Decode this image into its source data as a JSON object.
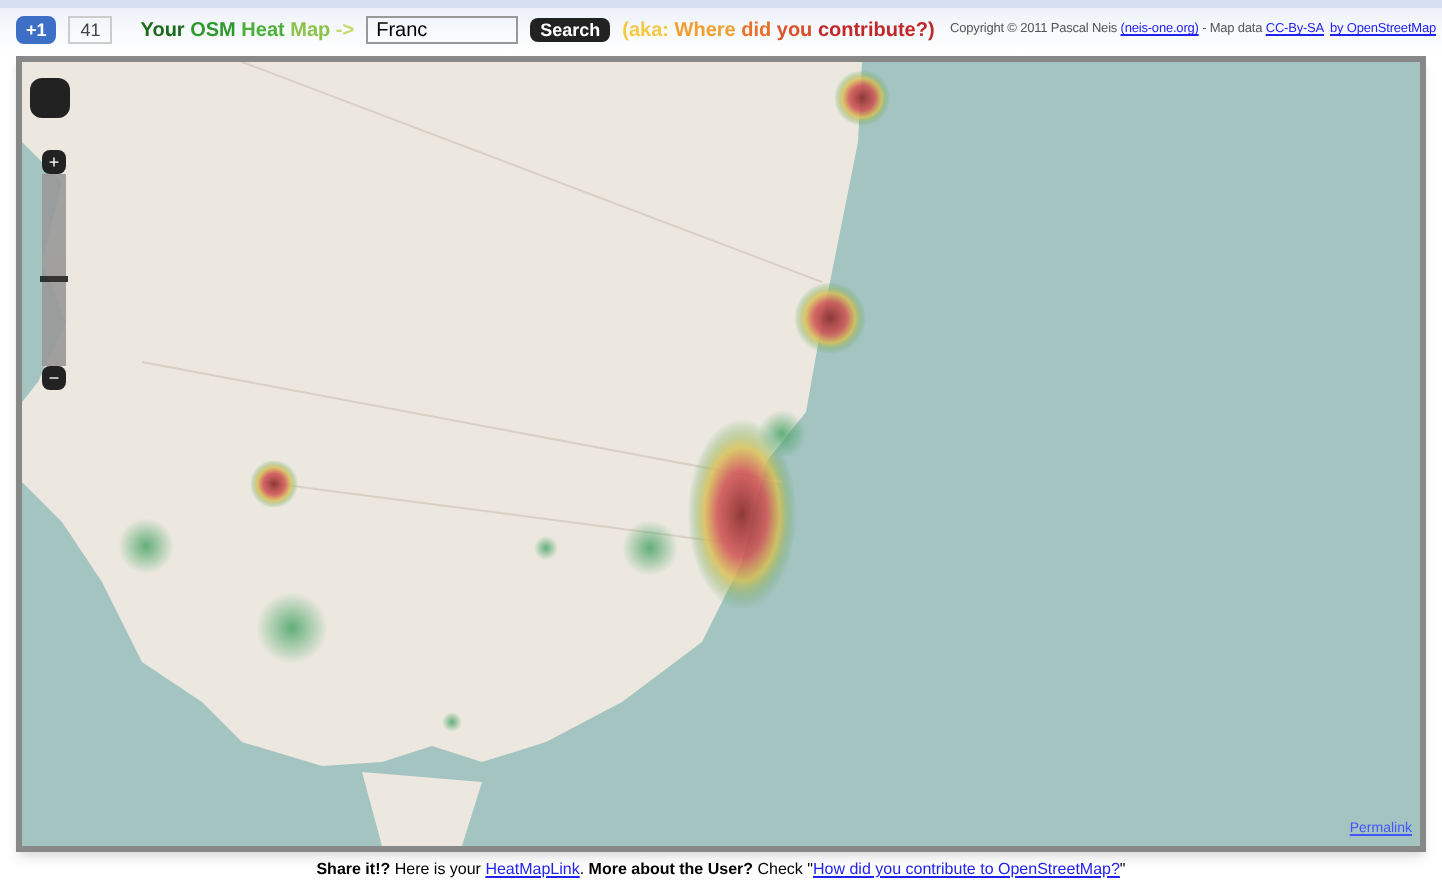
{
  "header": {
    "plus_one": {
      "label": "+1",
      "count": "41"
    },
    "title_parts": [
      {
        "text": "Your",
        "color": "#1a6b1a"
      },
      {
        "text": "OSM",
        "color": "#2e9a2e"
      },
      {
        "text": "Heat",
        "color": "#4caf3a"
      },
      {
        "text": "Map",
        "color": "#8bc34a"
      },
      {
        "text": "->",
        "color": "#c5d86d"
      }
    ],
    "search": {
      "value": "Franc",
      "button": "Search"
    },
    "tagline_parts": [
      {
        "text": "(aka:",
        "color": "#f5c842"
      },
      {
        "text": "Where",
        "color": "#f0a030"
      },
      {
        "text": "did",
        "color": "#e8702a"
      },
      {
        "text": "you",
        "color": "#d9502a"
      },
      {
        "text": "contribute?)",
        "color": "#c0282a"
      }
    ],
    "copyright": [
      {
        "kind": "text",
        "text": "Copyright © 2011 Pascal Neis "
      },
      {
        "kind": "link",
        "text": "(neis-one.org)"
      },
      {
        "kind": "text",
        "text": " - Map data "
      },
      {
        "kind": "link",
        "text": "CC-By-SA"
      },
      {
        "kind": "link",
        "text": "by OpenStreetMap"
      }
    ]
  },
  "map": {
    "zoom": {
      "in": "+",
      "out": "−",
      "level": 0.45
    },
    "permalink": "Permalink"
  },
  "footer": [
    {
      "kind": "bold",
      "text": "Share it!?"
    },
    {
      "kind": "text",
      "text": " Here is your "
    },
    {
      "kind": "link",
      "text": "HeatMapLink"
    },
    {
      "kind": "text",
      "text": ". "
    },
    {
      "kind": "bold",
      "text": "More about the User?"
    },
    {
      "kind": "text",
      "text": " Check \""
    },
    {
      "kind": "link",
      "text": "How did you contribute to OpenStreetMap?"
    },
    {
      "kind": "text",
      "text": "\""
    }
  ]
}
